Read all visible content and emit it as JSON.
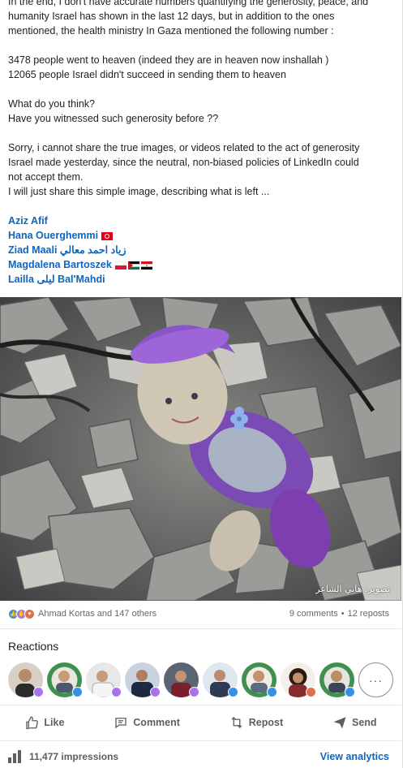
{
  "post": {
    "lines": [
      "In the end, I don't have accurate numbers quantifying the generosity, peace, and",
      "humanity Israel has shown in the last 12 days, but in addition to the ones",
      "mentioned, the health ministry In Gaza mentioned the following number :",
      "",
      "3478 people went to heaven (indeed they are in heaven now inshallah )",
      "12065 people Israel didn't succeed in sending them to heaven",
      "",
      "What do you think?",
      "Have you witnessed such generosity before ??",
      "",
      "Sorry, i cannot share the true images, or videos related to the act of generosity",
      "Israel made yesterday, since the neutral, non-biased policies of LinkedIn could",
      "not accept them.",
      "I will just share this simple image, describing what is left ..."
    ],
    "mentions": [
      {
        "name": "Aziz Afif",
        "flags": []
      },
      {
        "name": "Hana Ouerghemmi",
        "flags": [
          "tunisia-flag"
        ]
      },
      {
        "name": "Ziad Maali زياد احمد معالي",
        "flags": []
      },
      {
        "name": "Magdalena Bartoszek",
        "flags": [
          "poland-flag",
          "palestine-flag",
          "egypt-flag"
        ]
      },
      {
        "name": "Lailla ليلى Bal'Mahdi",
        "flags": []
      }
    ],
    "image_caption": "تصوير: هاني الشاعر"
  },
  "social": {
    "reactors_text": "Ahmad Kortas and 147 others",
    "comments": "9 comments",
    "separator": "•",
    "reposts": "12 reposts",
    "reaction_types": [
      "like-icon",
      "support-icon",
      "love-icon"
    ]
  },
  "reactions": {
    "title": "Reactions",
    "more_label": "···"
  },
  "actions": {
    "like": "Like",
    "comment": "Comment",
    "repost": "Repost",
    "send": "Send"
  },
  "impressions": {
    "count_text": "11,477 impressions",
    "analytics_label": "View analytics"
  },
  "colors": {
    "link": "#0a66c2",
    "like": "#378fe9",
    "support": "#a872e8",
    "love": "#df704d",
    "text_muted": "#666666"
  }
}
